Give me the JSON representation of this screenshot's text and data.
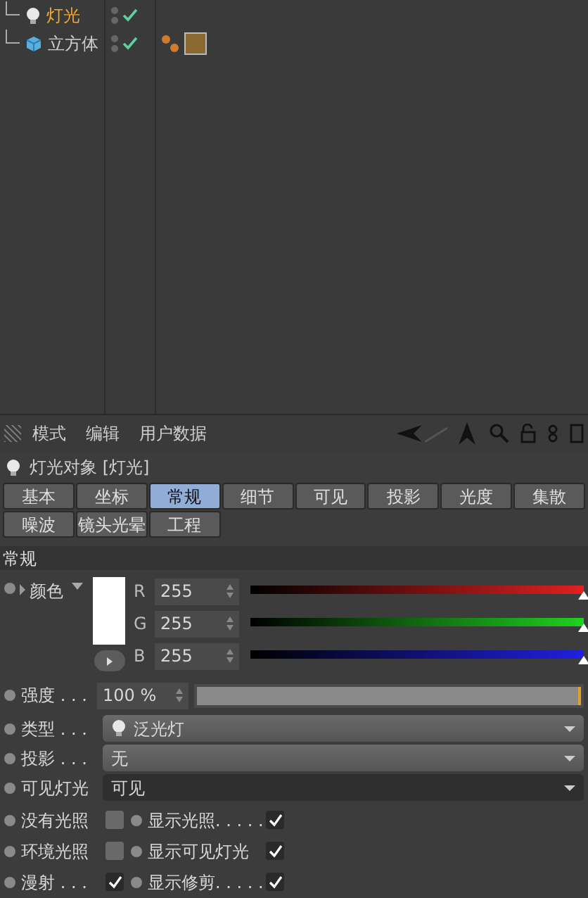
{
  "object_tree": [
    {
      "name": "灯光",
      "kind": "light",
      "selected": true,
      "enabled": true,
      "has_tags": false
    },
    {
      "name": "立方体",
      "kind": "cube",
      "selected": false,
      "enabled": true,
      "has_tags": true
    }
  ],
  "toolbar": {
    "menus": [
      "模式",
      "编辑",
      "用户数据"
    ]
  },
  "header": {
    "title": "灯光对象 [灯光]"
  },
  "tabs": [
    {
      "label": "基本",
      "selected": false
    },
    {
      "label": "坐标",
      "selected": false
    },
    {
      "label": "常规",
      "selected": true
    },
    {
      "label": "细节",
      "selected": false
    },
    {
      "label": "可见",
      "selected": false
    },
    {
      "label": "投影",
      "selected": false
    },
    {
      "label": "光度",
      "selected": false
    },
    {
      "label": "集散",
      "selected": false
    },
    {
      "label": "噪波",
      "selected": false
    },
    {
      "label": "镜头光晕",
      "selected": false
    },
    {
      "label": "工程",
      "selected": false
    }
  ],
  "section": "常规",
  "color": {
    "label": "颜色",
    "channels": [
      {
        "name": "R",
        "value": "255",
        "level": 1,
        "color": "#e02020"
      },
      {
        "name": "G",
        "value": "255",
        "level": 1,
        "color": "#20d020"
      },
      {
        "name": "B",
        "value": "255",
        "level": 1,
        "color": "#2020e0"
      }
    ]
  },
  "intensity": {
    "label": "强度 . . .",
    "value": "100 %",
    "level": 1
  },
  "dropdowns": [
    {
      "label": "类型 . . .",
      "value": "泛光灯",
      "kind": "icon"
    },
    {
      "label": "投影 . . .",
      "value": "无",
      "kind": "plain"
    },
    {
      "label": "可见灯光",
      "value": "可见",
      "kind": "dark"
    }
  ],
  "checkboxes": [
    [
      {
        "label": "没有光照",
        "checked": false
      },
      {
        "label": "显示光照. . . . .",
        "checked": true
      }
    ],
    [
      {
        "label": "环境光照",
        "checked": false
      },
      {
        "label": "显示可见灯光",
        "checked": true
      }
    ],
    [
      {
        "label": "漫射 . . .",
        "checked": true
      },
      {
        "label": "显示修剪. . . . .",
        "checked": true
      }
    ]
  ]
}
